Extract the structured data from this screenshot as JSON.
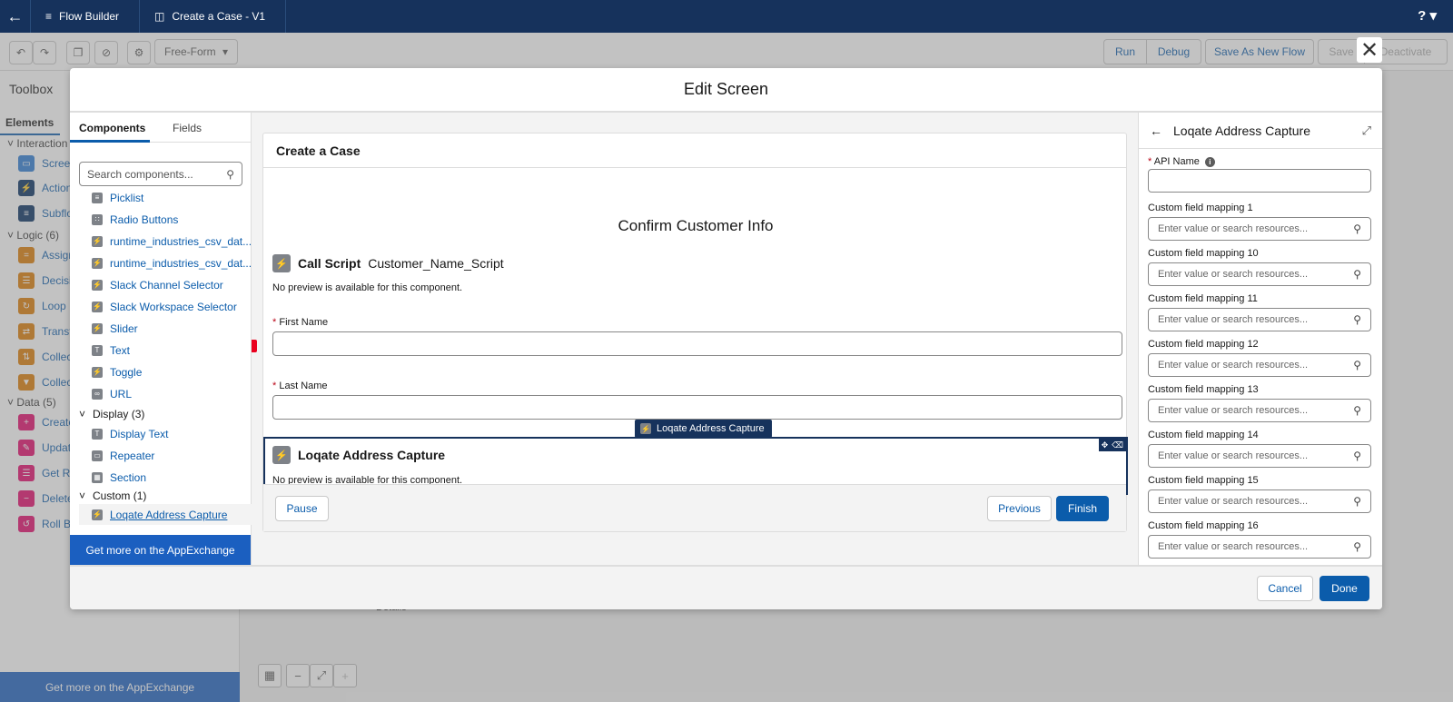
{
  "topbar": {
    "app_tab": "Flow Builder",
    "file_tab": "Create a Case - V1",
    "help": "?"
  },
  "toolbar": {
    "layout_mode": "Free-Form",
    "run": "Run",
    "debug": "Debug",
    "save_as_new": "Save As New Flow",
    "save": "Save",
    "deactivate": "Deactivate"
  },
  "toolbox": {
    "title": "Toolbox",
    "tab": "Elements",
    "groups": [
      {
        "label": "Interaction",
        "items": [
          "Screen",
          "Action",
          "Subflow"
        ]
      },
      {
        "label": "Logic (6)",
        "items": [
          "Assignment",
          "Decision",
          "Loop",
          "Transform",
          "Collection Sort",
          "Collection Filter"
        ]
      },
      {
        "label": "Data (5)",
        "items": [
          "Create Records",
          "Update Records",
          "Get Records",
          "Delete Records",
          "Roll Back Records"
        ]
      }
    ],
    "footer": "Get more on the AppExchange"
  },
  "canvas": {
    "details_label": "Details"
  },
  "modal": {
    "title": "Edit Screen",
    "palette": {
      "tabs": [
        "Components",
        "Fields"
      ],
      "search_placeholder": "Search components...",
      "items": [
        {
          "label": "Picklist",
          "icon": "list-icon"
        },
        {
          "label": "Radio Buttons",
          "icon": "radio-icon"
        },
        {
          "label": "runtime_industries_csv_dat...",
          "icon": "bolt-icon"
        },
        {
          "label": "runtime_industries_csv_dat...",
          "icon": "bolt-icon"
        },
        {
          "label": "Slack Channel Selector",
          "icon": "bolt-icon"
        },
        {
          "label": "Slack Workspace Selector",
          "icon": "bolt-icon"
        },
        {
          "label": "Slider",
          "icon": "bolt-icon"
        },
        {
          "label": "Text",
          "icon": "text-icon"
        },
        {
          "label": "Toggle",
          "icon": "bolt-icon"
        },
        {
          "label": "URL",
          "icon": "link-icon"
        }
      ],
      "display_group": "Display (3)",
      "display_items": [
        {
          "label": "Display Text",
          "icon": "text-icon"
        },
        {
          "label": "Repeater",
          "icon": "repeater-icon"
        },
        {
          "label": "Section",
          "icon": "section-icon"
        }
      ],
      "custom_group": "Custom (1)",
      "custom_items": [
        {
          "label": "Loqate Address Capture",
          "icon": "bolt-icon"
        }
      ],
      "footer": "Get more on the AppExchange"
    },
    "preview": {
      "card_title": "Create a Case",
      "heading": "Confirm Customer Info",
      "call_script_label": "Call Script",
      "call_script_name": "Customer_Name_Script",
      "no_preview": "No preview is available for this component.",
      "first_name_label": "First Name",
      "last_name_label": "Last Name",
      "drag_tag": "Loqate Address Capture",
      "selected_component": "Loqate Address Capture",
      "no_preview_2": "No preview is available for this component.",
      "pause": "Pause",
      "previous": "Previous",
      "finish": "Finish"
    },
    "properties": {
      "title": "Loqate Address Capture",
      "api_name_label": "API Name",
      "api_name_value": "",
      "placeholder": "Enter value or search resources...",
      "mappings": [
        "Custom field mapping 1",
        "Custom field mapping 10",
        "Custom field mapping 11",
        "Custom field mapping 12",
        "Custom field mapping 13",
        "Custom field mapping 14",
        "Custom field mapping 15",
        "Custom field mapping 16"
      ]
    },
    "cancel": "Cancel",
    "done": "Done"
  },
  "colors": {
    "brand": "#0b5cab",
    "nav": "#16325c",
    "appexchange": "#1b5fc0"
  }
}
